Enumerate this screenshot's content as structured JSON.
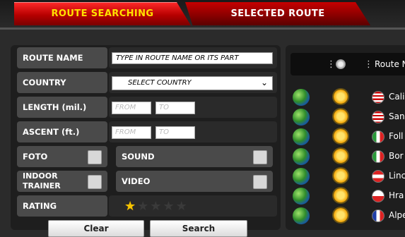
{
  "tabs": [
    {
      "label": "ROUTE SEARCHING"
    },
    {
      "label": "SELECTED ROUTE"
    }
  ],
  "search": {
    "route_name": {
      "label": "ROUTE NAME",
      "placeholder": "TYPE IN ROUTE NAME OR ITS PART"
    },
    "country": {
      "label": "COUNTRY",
      "selected": "SELECT COUNTRY"
    },
    "length": {
      "label": "LENGTH (mil.)",
      "from": "FROM",
      "to": "TO"
    },
    "ascent": {
      "label": "ASCENT (ft.)",
      "from": "FROM",
      "to": "TO"
    },
    "foto": {
      "label": "FOTO"
    },
    "sound": {
      "label": "SOUND"
    },
    "indoor": {
      "label": "INDOOR\nTRAINER"
    },
    "video": {
      "label": "VIDEO"
    },
    "rating": {
      "label": "RATING",
      "stars_filled": 1,
      "stars_total": 5
    },
    "buttons": {
      "clear": "Clear",
      "search": "Search"
    }
  },
  "results": {
    "header_label": "Route N",
    "rows": [
      {
        "name": "Cali",
        "flag": "us"
      },
      {
        "name": "San",
        "flag": "us"
      },
      {
        "name": "Foll",
        "flag": "it"
      },
      {
        "name": "Bor",
        "flag": "it"
      },
      {
        "name": "Linc",
        "flag": "at"
      },
      {
        "name": "Hra",
        "flag": "cz"
      },
      {
        "name": "Alpe",
        "flag": "fr"
      }
    ]
  }
}
